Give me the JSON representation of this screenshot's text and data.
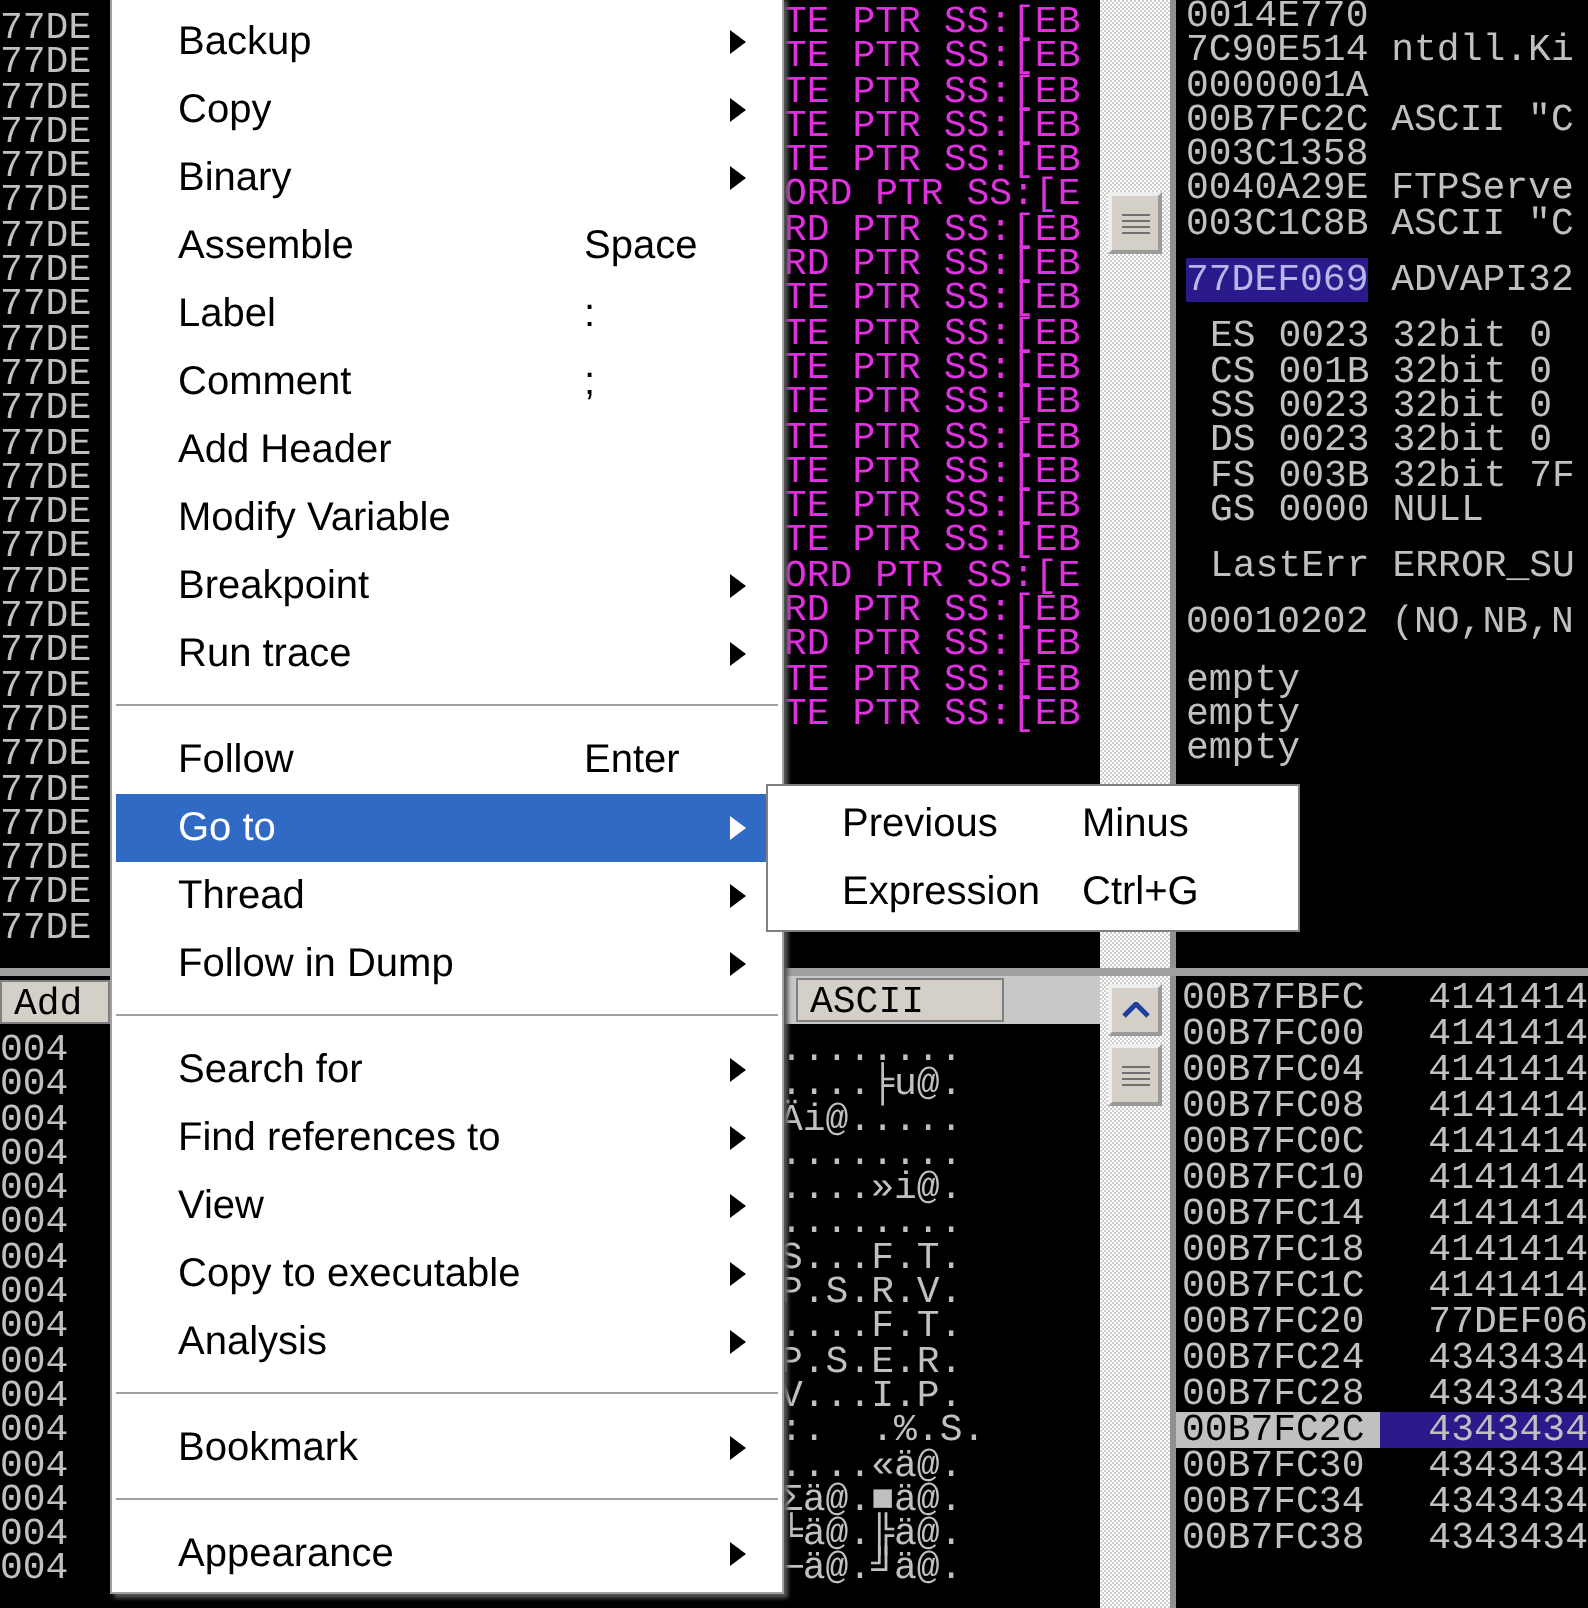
{
  "disassembly": {
    "addresses": [
      "77DE",
      "77DE",
      "77DE",
      "77DE",
      "77DE",
      "77DE",
      "77DE",
      "77DE",
      "77DE",
      "77DE",
      "77DE",
      "77DE",
      "77DE",
      "77DE",
      "77DE",
      "77DE",
      "77DE",
      "77DE",
      "77DE",
      "77DE",
      "77DE",
      "77DE",
      "77DE",
      "77DE",
      "77DE",
      "77DE",
      "77DE"
    ],
    "operands": [
      "TE PTR SS:[EB",
      "TE PTR SS:[EB",
      "TE PTR SS:[EB",
      "TE PTR SS:[EB",
      "TE PTR SS:[EB",
      "ORD PTR SS:[E",
      "RD PTR SS:[EB",
      "RD PTR SS:[EB",
      "TE PTR SS:[EB",
      "TE PTR SS:[EB",
      "TE PTR SS:[EB",
      "TE PTR SS:[EB",
      "TE PTR SS:[EB",
      "TE PTR SS:[EB",
      "TE PTR SS:[EB",
      "TE PTR SS:[EB",
      "ORD PTR SS:[E",
      "RD PTR SS:[EB",
      "RD PTR SS:[EB",
      "TE PTR SS:[EB",
      "TE PTR SS:[EB"
    ]
  },
  "registers": [
    {
      "kind": "plain",
      "lines": [
        {
          "address": "0014E770",
          "selected": false
        },
        {
          "address": "7C90E514",
          "comment": "ntdll.Ki",
          "selected": false
        },
        {
          "address": "0000001A",
          "selected": false
        },
        {
          "address": "00B7FC2C",
          "comment": "ASCII \"C",
          "selected": false
        },
        {
          "address": "003C1358",
          "selected": false
        },
        {
          "address": "0040A29E",
          "comment": "FTPServe",
          "selected": false
        },
        {
          "address": "003C1C8B",
          "comment": "ASCII \"C",
          "selected": false
        }
      ]
    },
    {
      "kind": "plain",
      "lines": [
        {
          "address": "77DEF069",
          "comment": "ADVAPI32",
          "selected": true
        }
      ]
    },
    {
      "kind": "indented",
      "lines": [
        {
          "address": "ES 0023",
          "comment": "32bit 0",
          "selected": false
        },
        {
          "address": "CS 001B",
          "comment": "32bit 0",
          "selected": false
        },
        {
          "address": "SS 0023",
          "comment": "32bit 0",
          "selected": false
        },
        {
          "address": "DS 0023",
          "comment": "32bit 0",
          "selected": false
        },
        {
          "address": "FS 003B",
          "comment": "32bit 7F",
          "selected": false
        },
        {
          "address": "GS 0000",
          "comment": "NULL",
          "selected": false
        }
      ]
    },
    {
      "kind": "indented",
      "lines": [
        {
          "address": "LastErr",
          "comment": "ERROR_SU",
          "selected": false
        }
      ]
    },
    {
      "kind": "plain",
      "lines": [
        {
          "address": "00010202",
          "comment": "(NO,NB,N",
          "selected": false
        }
      ]
    },
    {
      "kind": "plain",
      "lines": [
        {
          "address": "empty",
          "selected": false
        },
        {
          "address": "empty",
          "selected": false
        },
        {
          "address": "empty",
          "selected": false
        }
      ]
    }
  ],
  "dump": {
    "address_header": "Add",
    "ascii_header": "ASCII",
    "addresses": [
      "004",
      "004",
      "004",
      "004",
      "004",
      "004",
      "004",
      "004",
      "004",
      "004",
      "004",
      "004",
      "004",
      "004",
      "004",
      "004"
    ],
    "ascii": [
      "........",
      "....╞u@.",
      "Äi@.....",
      "........",
      "....»i@.",
      "........",
      "S...F.T.",
      "P.S.R.V.",
      "....F.T.",
      "P.S.E.R.",
      "V...I.P.",
      ":.  .%.S.",
      "....«ä@.",
      "Σä@.■ä@.",
      "╘ä@.╠ä@.",
      "─ä@.╝ä@."
    ]
  },
  "stack": [
    {
      "address": "00B7FBFC",
      "value": "4141414",
      "selected": false
    },
    {
      "address": "00B7FC00",
      "value": "4141414",
      "selected": false
    },
    {
      "address": "00B7FC04",
      "value": "4141414",
      "selected": false
    },
    {
      "address": "00B7FC08",
      "value": "4141414",
      "selected": false
    },
    {
      "address": "00B7FC0C",
      "value": "4141414",
      "selected": false
    },
    {
      "address": "00B7FC10",
      "value": "4141414",
      "selected": false
    },
    {
      "address": "00B7FC14",
      "value": "4141414",
      "selected": false
    },
    {
      "address": "00B7FC18",
      "value": "4141414",
      "selected": false
    },
    {
      "address": "00B7FC1C",
      "value": "4141414",
      "selected": false
    },
    {
      "address": "00B7FC20",
      "value": "77DEF06",
      "selected": false
    },
    {
      "address": "00B7FC24",
      "value": "4343434",
      "selected": false
    },
    {
      "address": "00B7FC28",
      "value": "4343434",
      "selected": false
    },
    {
      "address": "00B7FC2C",
      "value": "4343434",
      "selected": true
    },
    {
      "address": "00B7FC30",
      "value": "4343434",
      "selected": false
    },
    {
      "address": "00B7FC34",
      "value": "4343434",
      "selected": false
    },
    {
      "address": "00B7FC38",
      "value": "4343434",
      "selected": false
    }
  ],
  "context_menu": [
    {
      "kind": "item",
      "label": "Backup",
      "submenu": true,
      "selected": false
    },
    {
      "kind": "item",
      "label": "Copy",
      "submenu": true,
      "selected": false
    },
    {
      "kind": "item",
      "label": "Binary",
      "submenu": true,
      "selected": false
    },
    {
      "kind": "item",
      "label": "Assemble",
      "shortcut": "Space",
      "submenu": false,
      "selected": false
    },
    {
      "kind": "item",
      "label": "Label",
      "shortcut": ":",
      "submenu": false,
      "selected": false
    },
    {
      "kind": "item",
      "label": "Comment",
      "shortcut": ";",
      "submenu": false,
      "selected": false
    },
    {
      "kind": "item",
      "label": "Add Header",
      "submenu": false,
      "selected": false
    },
    {
      "kind": "item",
      "label": "Modify Variable",
      "submenu": false,
      "selected": false
    },
    {
      "kind": "item",
      "label": "Breakpoint",
      "submenu": true,
      "selected": false
    },
    {
      "kind": "item",
      "label": "Run trace",
      "submenu": true,
      "selected": false
    },
    {
      "kind": "separator"
    },
    {
      "kind": "item",
      "label": "Follow",
      "shortcut": "Enter",
      "submenu": false,
      "selected": false
    },
    {
      "kind": "item",
      "label": "Go to",
      "submenu": true,
      "selected": true
    },
    {
      "kind": "item",
      "label": "Thread",
      "submenu": true,
      "selected": false
    },
    {
      "kind": "item",
      "label": "Follow in Dump",
      "submenu": true,
      "selected": false
    },
    {
      "kind": "separator"
    },
    {
      "kind": "item",
      "label": "Search for",
      "submenu": true,
      "selected": false
    },
    {
      "kind": "item",
      "label": "Find references to",
      "submenu": true,
      "selected": false
    },
    {
      "kind": "item",
      "label": "View",
      "submenu": true,
      "selected": false
    },
    {
      "kind": "item",
      "label": "Copy to executable",
      "submenu": true,
      "selected": false
    },
    {
      "kind": "item",
      "label": "Analysis",
      "submenu": true,
      "selected": false
    },
    {
      "kind": "separator"
    },
    {
      "kind": "item",
      "label": "Bookmark",
      "submenu": true,
      "selected": false
    },
    {
      "kind": "separator"
    },
    {
      "kind": "item",
      "label": "Appearance",
      "submenu": true,
      "selected": false
    }
  ],
  "submenu": [
    {
      "label": "Previous",
      "shortcut": "Minus"
    },
    {
      "label": "Expression",
      "shortcut": "Ctrl+G"
    }
  ]
}
